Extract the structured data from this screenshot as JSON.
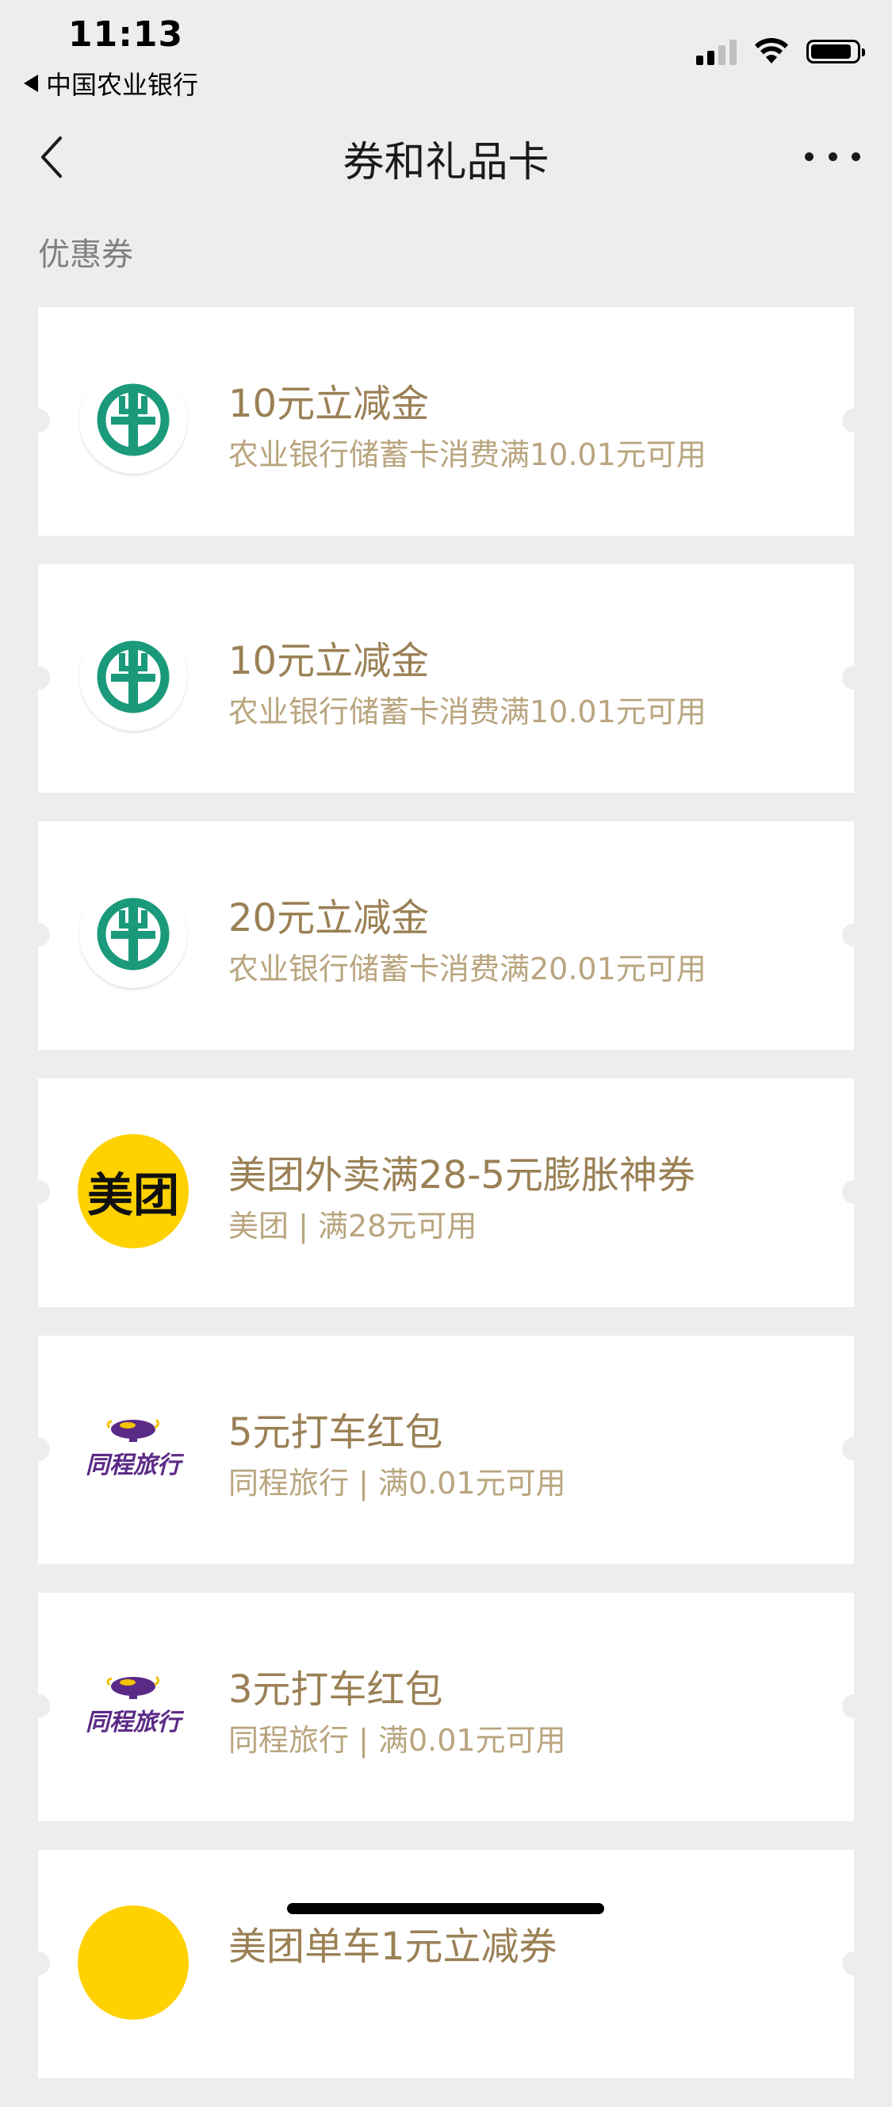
{
  "status_bar": {
    "time": "11:13",
    "back_app": "中国农业银行"
  },
  "nav": {
    "title": "券和礼品卡"
  },
  "section": {
    "label": "优惠券"
  },
  "coupons": [
    {
      "logo": "abc-bank-logo",
      "title": "10元立减金",
      "desc": "农业银行储蓄卡消费满10.01元可用"
    },
    {
      "logo": "abc-bank-logo",
      "title": "10元立减金",
      "desc": "农业银行储蓄卡消费满10.01元可用"
    },
    {
      "logo": "abc-bank-logo",
      "title": "20元立减金",
      "desc": "农业银行储蓄卡消费满20.01元可用"
    },
    {
      "logo": "meituan-logo",
      "logo_text": "美团",
      "title": "美团外卖满28-5元膨胀神券",
      "desc": "美团 | 满28元可用"
    },
    {
      "logo": "tongcheng-logo",
      "logo_text": "同程旅行",
      "title": "5元打车红包",
      "desc": "同程旅行 | 满0.01元可用"
    },
    {
      "logo": "tongcheng-logo",
      "logo_text": "同程旅行",
      "title": "3元打车红包",
      "desc": "同程旅行 | 满0.01元可用"
    },
    {
      "logo": "meituan-logo",
      "logo_text": "",
      "title": "美团单车1元立减券",
      "desc": ""
    }
  ],
  "colors": {
    "background": "#ededed",
    "card": "#ffffff",
    "coupon_title": "#9a8055",
    "coupon_desc": "#b9a57f",
    "abc_green": "#1a9a7a",
    "meituan_yellow": "#ffd100",
    "tongcheng_purple": "#5b2a86"
  }
}
